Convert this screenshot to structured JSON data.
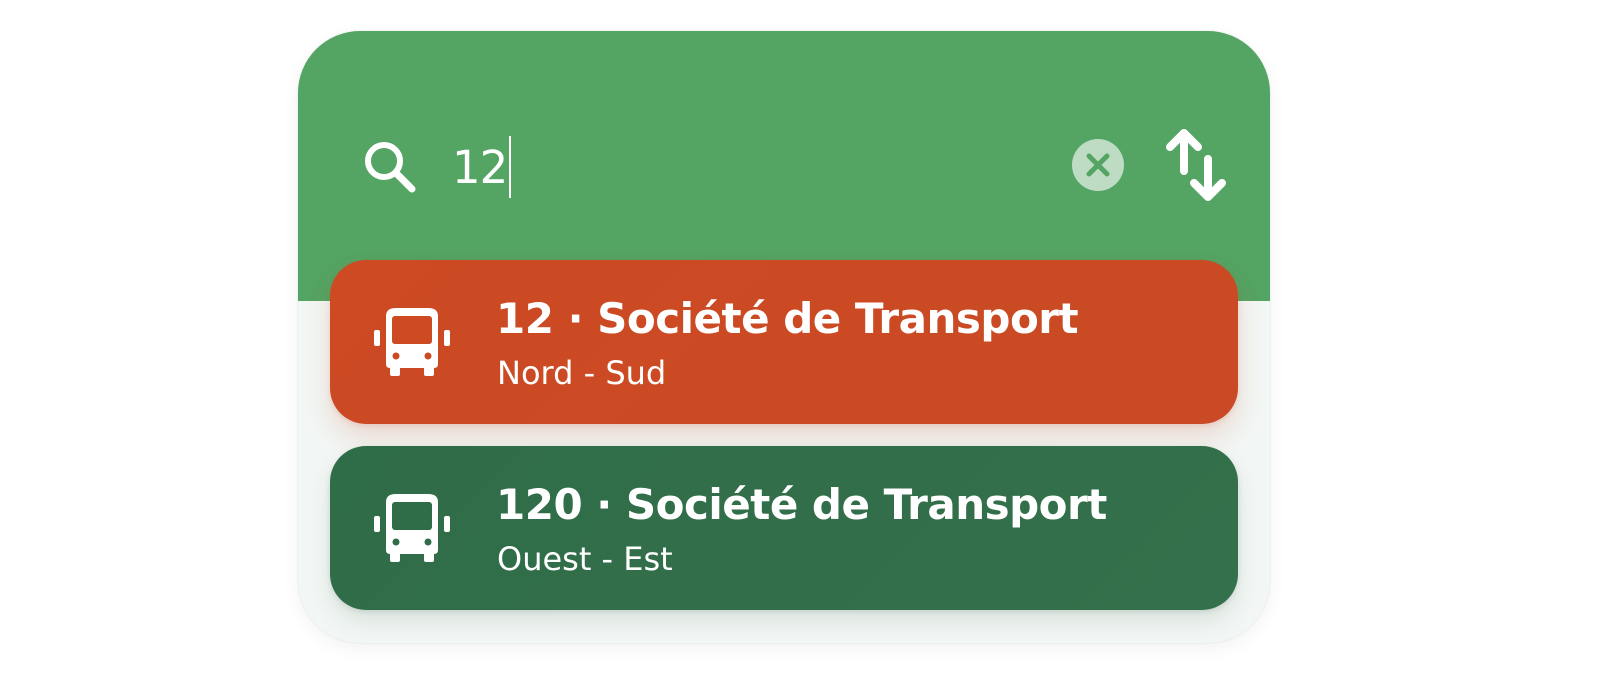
{
  "search": {
    "query": "12"
  },
  "colors": {
    "header": "#54a463",
    "route_orange": "#cd4a23",
    "route_green": "#2f6c48"
  },
  "icons": [
    "search-icon",
    "clear-icon",
    "swap-icon",
    "bus-icon"
  ],
  "results": [
    {
      "title": "12 · Société de Transport",
      "subtitle": "Nord - Sud",
      "icon": "bus-icon",
      "color": "#cd4a23"
    },
    {
      "title": "120 · Société de Transport",
      "subtitle": "Ouest - Est",
      "icon": "bus-icon",
      "color": "#2f6c48"
    }
  ]
}
